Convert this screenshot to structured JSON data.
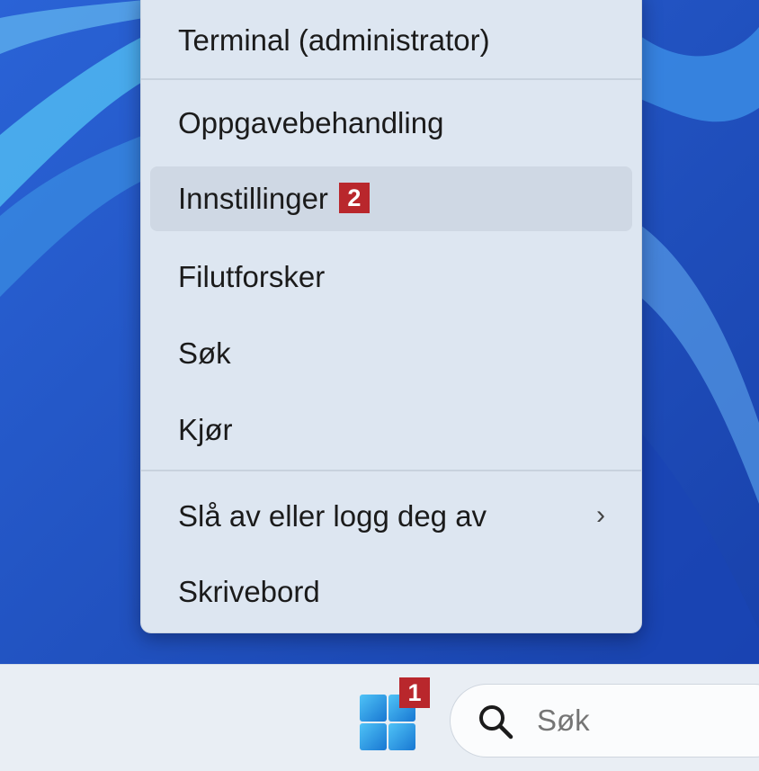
{
  "context_menu": {
    "items": [
      {
        "label": "Terminal (administrator)"
      },
      {
        "label": "Oppgavebehandling"
      },
      {
        "label": "Innstillinger",
        "badge": "2"
      },
      {
        "label": "Filutforsker"
      },
      {
        "label": "Søk"
      },
      {
        "label": "Kjør"
      },
      {
        "label": "Slå av eller logg deg av",
        "submenu_icon": "chevron-right-icon"
      },
      {
        "label": "Skrivebord"
      }
    ]
  },
  "taskbar": {
    "start_badge": "1",
    "start_icon": "windows-logo-icon",
    "search": {
      "placeholder": "Søk",
      "icon": "search-icon"
    }
  },
  "colors": {
    "badge": "#b9272c",
    "menu_bg": "#dde6f1",
    "wallpaper": "#1d4fc4"
  }
}
